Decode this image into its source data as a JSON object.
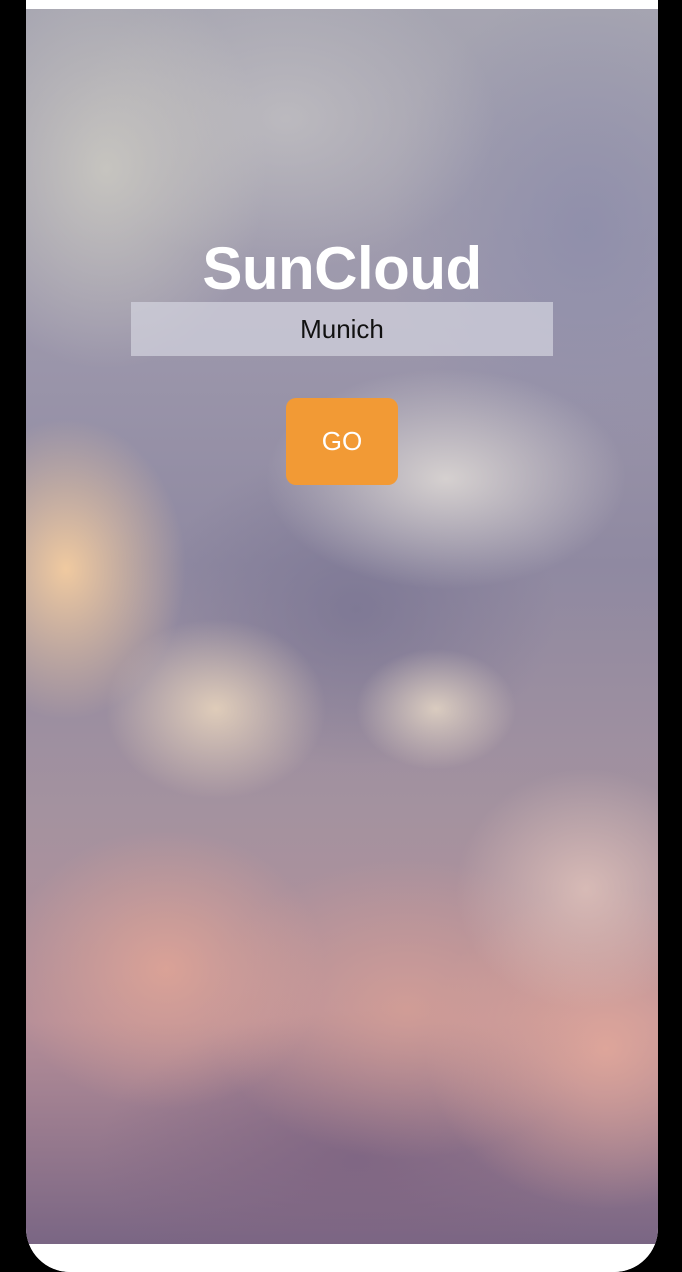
{
  "app": {
    "title": "SunCloud"
  },
  "search": {
    "value": "Munich",
    "placeholder": ""
  },
  "actions": {
    "go_label": "GO"
  },
  "colors": {
    "accent": "#f29a35",
    "title_text": "#ffffff",
    "input_background": "#d2d2de"
  }
}
